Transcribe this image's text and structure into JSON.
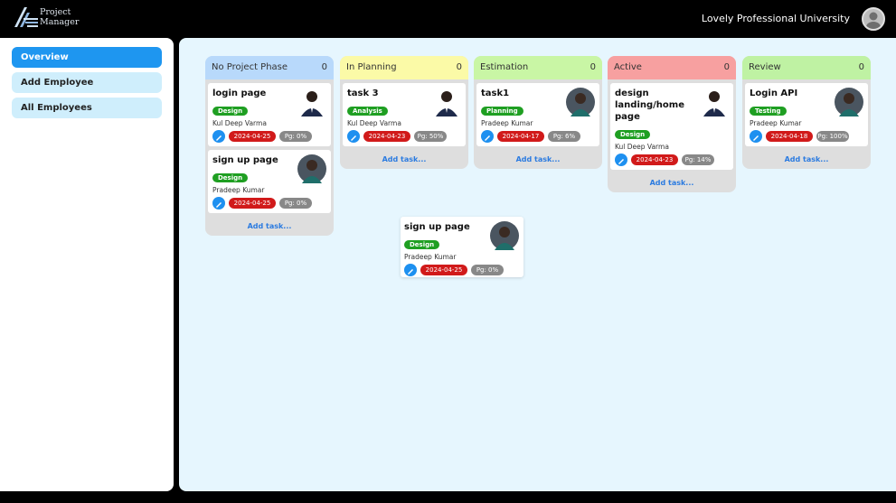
{
  "header": {
    "brand_line1": "Project",
    "brand_line2": "Manager",
    "university": "Lovely Professional University"
  },
  "sidebar": {
    "items": [
      {
        "label": "Overview",
        "active": true
      },
      {
        "label": "Add Employee",
        "active": false
      },
      {
        "label": "All Employees",
        "active": false
      }
    ]
  },
  "colors": {
    "accent": "#1e96f0",
    "tag": "#1f9f22",
    "date": "#d11a1a",
    "progress": "#888888"
  },
  "columns": [
    {
      "name": "No Project Phase",
      "count": "0",
      "color": "#b8d9fb",
      "cards": [
        {
          "title": "login page",
          "tag": "Design",
          "assignee": "Kul Deep Varma",
          "date": "2024-04-25",
          "progress": "Pg: 0%",
          "avatar": "man-suit"
        },
        {
          "title": "sign up page",
          "tag": "Design",
          "assignee": "Pradeep Kumar",
          "date": "2024-04-25",
          "progress": "Pg: 0%",
          "avatar": "man-photo"
        }
      ],
      "add_label": "Add task..."
    },
    {
      "name": "In Planning",
      "count": "0",
      "color": "#fbfaa7",
      "cards": [
        {
          "title": "task 3",
          "tag": "Analysis",
          "assignee": "Kul Deep Varma",
          "date": "2024-04-23",
          "progress": "Pg: 50%",
          "avatar": "man-suit"
        }
      ],
      "add_label": "Add task..."
    },
    {
      "name": "Estimation",
      "count": "0",
      "color": "#c9f6a5",
      "cards": [
        {
          "title": "task1",
          "tag": "Planning",
          "assignee": "Pradeep Kumar",
          "date": "2024-04-17",
          "progress": "Pg: 6%",
          "avatar": "man-photo"
        }
      ],
      "add_label": "Add task..."
    },
    {
      "name": "Active",
      "count": "0",
      "color": "#f7a0a0",
      "cards": [
        {
          "title": "design landing/home page",
          "tag": "Design",
          "assignee": "Kul Deep Varma",
          "date": "2024-04-23",
          "progress": "Pg: 14%",
          "avatar": "man-suit"
        }
      ],
      "add_label": "Add task..."
    },
    {
      "name": "Review",
      "count": "0",
      "color": "#bff2a3",
      "cards": [
        {
          "title": "Login API",
          "tag": "Testing",
          "assignee": "Pradeep Kumar",
          "date": "2024-04-18",
          "progress": "Pg: 100%",
          "avatar": "man-photo"
        }
      ],
      "add_label": "Add task..."
    }
  ],
  "dragging_card": {
    "title": "sign up page",
    "tag": "Design",
    "assignee": "Pradeep Kumar",
    "date": "2024-04-25",
    "progress": "Pg: 0%",
    "avatar": "man-photo"
  }
}
